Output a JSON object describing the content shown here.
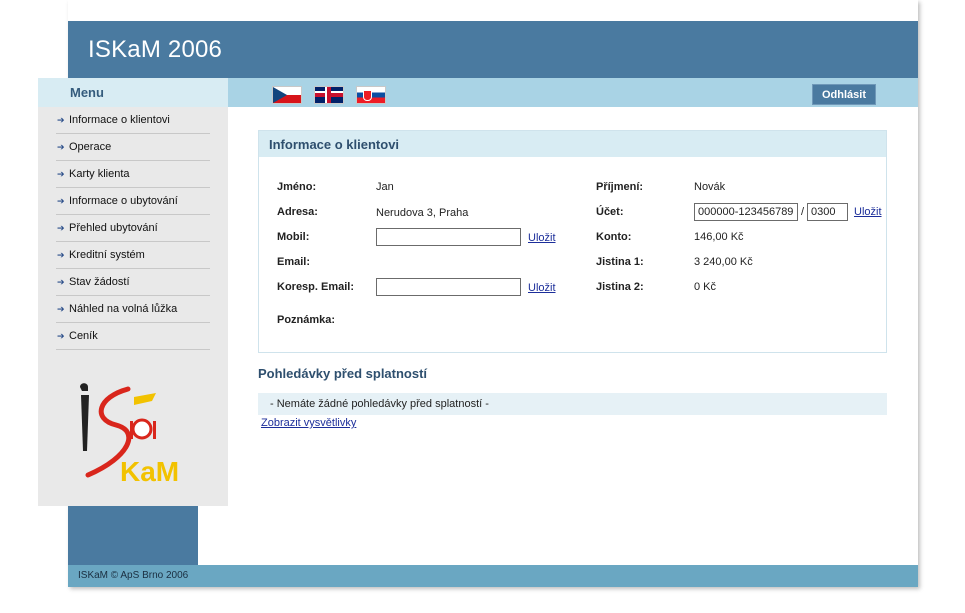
{
  "app": {
    "title": "ISKaM 2006"
  },
  "nav": {
    "menu_title": "Menu",
    "logout_label": "Odhlásit",
    "flags": [
      "czech-flag-icon",
      "uk-flag-icon",
      "slovak-flag-icon"
    ]
  },
  "sidebar": {
    "items": [
      {
        "label": "Informace o klientovi"
      },
      {
        "label": "Operace"
      },
      {
        "label": "Karty klienta"
      },
      {
        "label": "Informace o ubytování"
      },
      {
        "label": "Přehled ubytování"
      },
      {
        "label": "Kreditní systém"
      },
      {
        "label": "Stav žádostí"
      },
      {
        "label": "Náhled na volná lůžka"
      },
      {
        "label": "Ceník"
      }
    ],
    "logo_text": "KaM"
  },
  "client_info": {
    "title": "Informace o klientovi",
    "left": {
      "first_name_label": "Jméno:",
      "first_name": "Jan",
      "address_label": "Adresa:",
      "address": "Nerudova 3, Praha",
      "mobile_label": "Mobil:",
      "mobile_value": "",
      "email_label": "Email:",
      "corr_email_label": "Koresp. Email:",
      "corr_email_value": "",
      "note_label": "Poznámka:",
      "save_label": "Uložit"
    },
    "right": {
      "last_name_label": "Příjmení:",
      "last_name": "Novák",
      "account_label": "Účet:",
      "account_number": "000000-123456789",
      "bank_code": "0300",
      "slash": "/",
      "balance_label": "Konto:",
      "balance": "146,00 Kč",
      "deposit1_label": "Jistina 1:",
      "deposit1": "3 240,00 Kč",
      "deposit2_label": "Jistina 2:",
      "deposit2": "0 Kč",
      "save_label": "Uložit"
    }
  },
  "receivables": {
    "title": "Pohledávky před splatností",
    "empty_message": "- Nemáte žádné pohledávky před splatností -",
    "show_legend_link": "Zobrazit vysvětlivky"
  },
  "footer": {
    "text": "ISKaM © ApS Brno 2006"
  },
  "colors": {
    "header": "#4a7aa0",
    "strip": "#6aa7c2",
    "navbar": "#a9d3e5",
    "panel_head": "#d8ecf3",
    "sidebar": "#e9e9e9"
  }
}
